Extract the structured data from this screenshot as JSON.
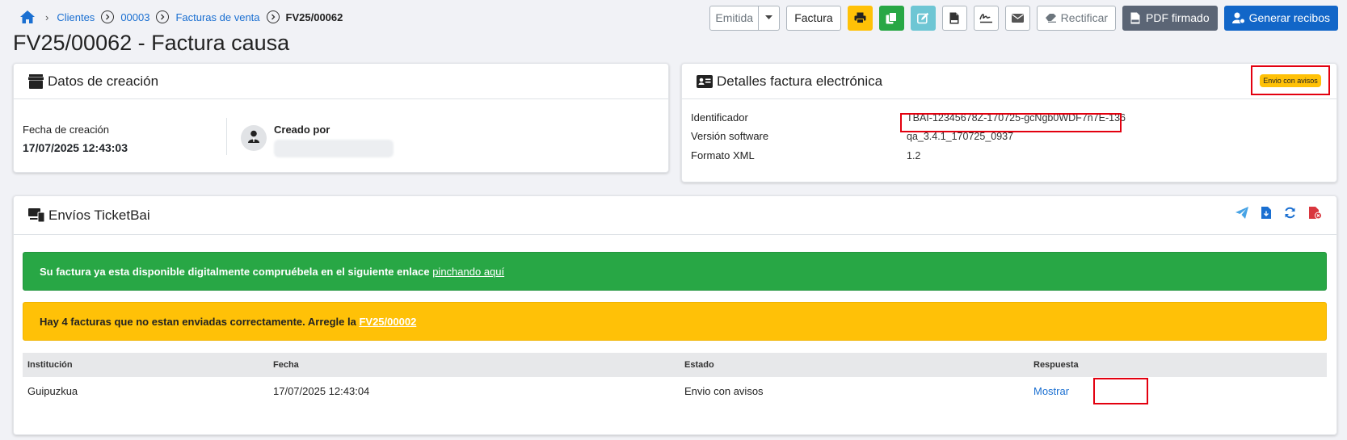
{
  "breadcrumb": {
    "items": [
      "Clientes",
      "00003",
      "Facturas de venta"
    ],
    "current": "FV25/00062"
  },
  "page": {
    "title": "FV25/00062 - Factura causa"
  },
  "toolbar": {
    "status_select": "Emitida",
    "factura_label": "Factura",
    "rectificar_label": "Rectificar",
    "pdf_firmado_label": "PDF firmado",
    "generar_recibos_label": "Generar recibos",
    "colors": {
      "print": "#ffc107",
      "copy": "#28a745",
      "edit": "#6ec6d4",
      "pdf": "#5b6575",
      "primary": "#1266c8"
    }
  },
  "creation": {
    "title": "Datos de creación",
    "date_label": "Fecha de creación",
    "date_value": "17/07/2025 12:43:03",
    "created_by_label": "Creado por"
  },
  "einvoice": {
    "title": "Detalles factura electrónica",
    "badge": "Envio con avisos",
    "rows": [
      {
        "label": "Identificador",
        "value": "TBAI-12345678Z-170725-gcNgb0WDF7n7E-136"
      },
      {
        "label": "Versión software",
        "value": "qa_3.4.1_170725_0937"
      },
      {
        "label": "Formato XML",
        "value": "1.2"
      }
    ]
  },
  "ticketbai": {
    "title": "Envíos TicketBai",
    "alert_success_text": "Su factura ya esta disponible digitalmente compruébela en el siguiente enlace ",
    "alert_success_link": "pinchando aquí",
    "alert_warning_text": "Hay 4 facturas que no estan enviadas correctamente. Arregle la ",
    "alert_warning_link": "FV25/00002",
    "table": {
      "headers": [
        "Institución",
        "Fecha",
        "Estado",
        "Respuesta"
      ],
      "rows": [
        {
          "institucion": "Guipuzkua",
          "fecha": "17/07/2025 12:43:04",
          "estado": "Envio con avisos",
          "respuesta": "Mostrar"
        }
      ]
    }
  }
}
